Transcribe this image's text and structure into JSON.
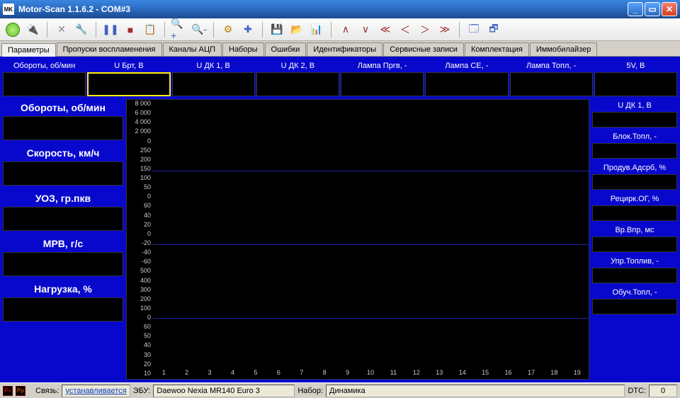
{
  "window": {
    "title": "Motor-Scan 1.1.6.2 - COM#3",
    "app_icon_text": "MK"
  },
  "tabs": [
    "Параметры",
    "Пропуски воспламенения",
    "Каналы АЦП",
    "Наборы",
    "Ошибки",
    "Идентификаторы",
    "Сервисные записи",
    "Комплектация",
    "Иммобилайзер"
  ],
  "top_params": [
    {
      "label": "Обороты, об/мин"
    },
    {
      "label": "U Брт, В",
      "selected": true
    },
    {
      "label": "U ДК 1, В"
    },
    {
      "label": "U ДК 2, В"
    },
    {
      "label": "Лампа Пргв, -"
    },
    {
      "label": "Лампа CE, -"
    },
    {
      "label": "Лампа Топл, -"
    },
    {
      "label": "5V, В"
    }
  ],
  "left_params": [
    {
      "label": "Обороты, об/мин"
    },
    {
      "label": "Скорость, км/ч"
    },
    {
      "label": "УОЗ, гр.пкв"
    },
    {
      "label": "МРВ, г/с"
    },
    {
      "label": "Нагрузка, %"
    }
  ],
  "right_params": [
    {
      "label": "U ДК 1, В"
    },
    {
      "label": "Блок.Топл, -"
    },
    {
      "label": "Продув.Адсрб, %"
    },
    {
      "label": "Рецирк.ОГ, %"
    },
    {
      "label": "Вр.Впр, мс"
    },
    {
      "label": "Упр.Топлив, -"
    },
    {
      "label": "Обуч.Топл, -"
    }
  ],
  "chart": {
    "y_ticks": [
      "8 000",
      "6 000",
      "4 000",
      "2 000",
      "0",
      "250",
      "200",
      "150",
      "100",
      "50",
      "0",
      "60",
      "40",
      "20",
      "0",
      "-20",
      "-40",
      "-60",
      "500",
      "400",
      "300",
      "200",
      "100",
      "0",
      "60",
      "50",
      "40",
      "30",
      "20",
      "10"
    ],
    "x_ticks": [
      "1",
      "2",
      "3",
      "4",
      "5",
      "6",
      "7",
      "8",
      "9",
      "10",
      "11",
      "12",
      "13",
      "14",
      "15",
      "16",
      "17",
      "18",
      "19"
    ]
  },
  "status": {
    "connection_label": "Связь:",
    "connection_value": "устанавливается",
    "ecu_label": "ЭБУ:",
    "ecu_value": "Daewoo Nexia MR140 Euro 3",
    "set_label": "Набор:",
    "set_value": "Динамика",
    "dtc_label": "DTC:",
    "dtc_value": "0"
  }
}
